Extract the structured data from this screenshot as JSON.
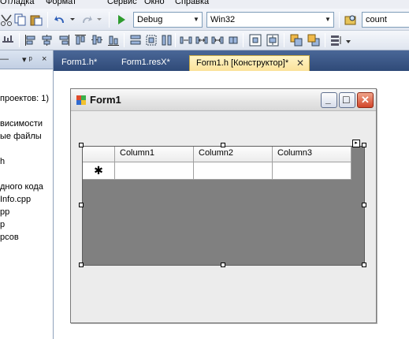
{
  "menu": [
    "Отладка",
    "Формат",
    "Сервис",
    "Окно",
    "Справка"
  ],
  "toolbar": {
    "config_value": "Debug",
    "platform_value": "Win32",
    "find_value": "count"
  },
  "explorer": {
    "header_pin": "▾ ᵖ",
    "header_close": "×",
    "items": [
      "проектов: 1)",
      "висимости",
      "ые файлы",
      "h",
      "дного кода",
      "Info.cpp",
      "pp",
      "p",
      "рсов"
    ]
  },
  "tabs": [
    {
      "label": "Form1.h*",
      "active": false
    },
    {
      "label": "Form1.resX*",
      "active": false
    },
    {
      "label": "Form1.h [Конструктор]*",
      "active": true,
      "close": "✕"
    }
  ],
  "form": {
    "title": "Form1",
    "min_btn": "_",
    "max_btn": "□",
    "close_btn": "✕"
  },
  "grid": {
    "columns": [
      "Column1",
      "Column2",
      "Column3"
    ],
    "new_row_marker": "✱",
    "tasks_glyph": "▸"
  },
  "colors": {
    "accent": "#2f4a78",
    "active_tab": "#fbe29a",
    "grid_background": "#808080",
    "close_button": "#d2452a"
  }
}
